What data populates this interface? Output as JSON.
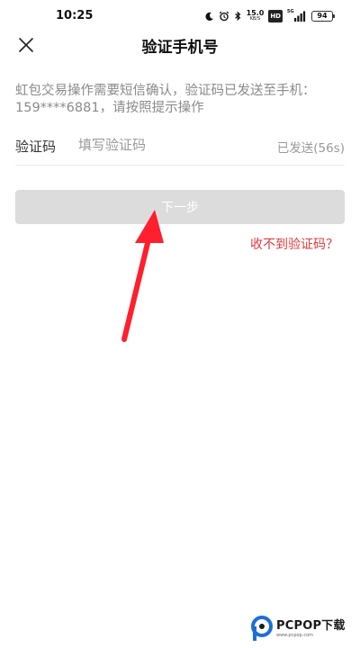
{
  "status_bar": {
    "time": "10:25",
    "icons": [
      "moon-icon",
      "alarm-icon",
      "bluetooth-icon",
      "hd-badge",
      "signal-5g-icon",
      "battery-icon"
    ],
    "net_speed_value": "15.0",
    "net_speed_unit": "KB/S",
    "hd_label": "HD",
    "signal_label": "5G",
    "battery_level": "94"
  },
  "header": {
    "title": "验证手机号",
    "close_icon": "close-icon"
  },
  "notice": {
    "text": "虹包交易操作需要短信确认，验证码已发送至手机：159****6881，请按照提示操作"
  },
  "code_field": {
    "label": "验证码",
    "placeholder": "填写验证码",
    "value": "",
    "resend_status": "已发送(56s)"
  },
  "next_button": {
    "label": "下一步",
    "enabled": false
  },
  "no_code_link": "收不到验证码？",
  "watermark": {
    "brand": "PCPOP下载",
    "url": "www.pcpop.com"
  },
  "colors": {
    "link_red": "#e4393c",
    "button_disabled": "#dcdcdc",
    "arrow_red": "#ff1f2d",
    "hint_gray": "#9a9a9a"
  }
}
